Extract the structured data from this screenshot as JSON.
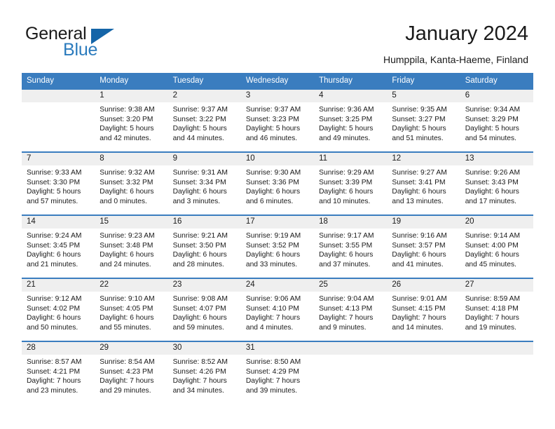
{
  "brand": {
    "name_top": "General",
    "name_bottom": "Blue",
    "triangle_icon": "blue-triangle-logo-icon",
    "color_dark": "#1a1a1a",
    "color_blue": "#2b7bbd"
  },
  "header": {
    "title": "January 2024",
    "subtitle": "Humppila, Kanta-Haeme, Finland"
  },
  "theme": {
    "header_blue": "#3a7dbf",
    "daynum_band": "#efefef",
    "text": "#1a1a1a"
  },
  "calendar": {
    "weekdays": [
      "Sunday",
      "Monday",
      "Tuesday",
      "Wednesday",
      "Thursday",
      "Friday",
      "Saturday"
    ],
    "weeks": [
      [
        {
          "day": "",
          "sunrise": "",
          "sunset": "",
          "daylight_line1": "",
          "daylight_line2": ""
        },
        {
          "day": "1",
          "sunrise": "Sunrise: 9:38 AM",
          "sunset": "Sunset: 3:20 PM",
          "daylight_line1": "Daylight: 5 hours",
          "daylight_line2": "and 42 minutes."
        },
        {
          "day": "2",
          "sunrise": "Sunrise: 9:37 AM",
          "sunset": "Sunset: 3:22 PM",
          "daylight_line1": "Daylight: 5 hours",
          "daylight_line2": "and 44 minutes."
        },
        {
          "day": "3",
          "sunrise": "Sunrise: 9:37 AM",
          "sunset": "Sunset: 3:23 PM",
          "daylight_line1": "Daylight: 5 hours",
          "daylight_line2": "and 46 minutes."
        },
        {
          "day": "4",
          "sunrise": "Sunrise: 9:36 AM",
          "sunset": "Sunset: 3:25 PM",
          "daylight_line1": "Daylight: 5 hours",
          "daylight_line2": "and 49 minutes."
        },
        {
          "day": "5",
          "sunrise": "Sunrise: 9:35 AM",
          "sunset": "Sunset: 3:27 PM",
          "daylight_line1": "Daylight: 5 hours",
          "daylight_line2": "and 51 minutes."
        },
        {
          "day": "6",
          "sunrise": "Sunrise: 9:34 AM",
          "sunset": "Sunset: 3:29 PM",
          "daylight_line1": "Daylight: 5 hours",
          "daylight_line2": "and 54 minutes."
        }
      ],
      [
        {
          "day": "7",
          "sunrise": "Sunrise: 9:33 AM",
          "sunset": "Sunset: 3:30 PM",
          "daylight_line1": "Daylight: 5 hours",
          "daylight_line2": "and 57 minutes."
        },
        {
          "day": "8",
          "sunrise": "Sunrise: 9:32 AM",
          "sunset": "Sunset: 3:32 PM",
          "daylight_line1": "Daylight: 6 hours",
          "daylight_line2": "and 0 minutes."
        },
        {
          "day": "9",
          "sunrise": "Sunrise: 9:31 AM",
          "sunset": "Sunset: 3:34 PM",
          "daylight_line1": "Daylight: 6 hours",
          "daylight_line2": "and 3 minutes."
        },
        {
          "day": "10",
          "sunrise": "Sunrise: 9:30 AM",
          "sunset": "Sunset: 3:36 PM",
          "daylight_line1": "Daylight: 6 hours",
          "daylight_line2": "and 6 minutes."
        },
        {
          "day": "11",
          "sunrise": "Sunrise: 9:29 AM",
          "sunset": "Sunset: 3:39 PM",
          "daylight_line1": "Daylight: 6 hours",
          "daylight_line2": "and 10 minutes."
        },
        {
          "day": "12",
          "sunrise": "Sunrise: 9:27 AM",
          "sunset": "Sunset: 3:41 PM",
          "daylight_line1": "Daylight: 6 hours",
          "daylight_line2": "and 13 minutes."
        },
        {
          "day": "13",
          "sunrise": "Sunrise: 9:26 AM",
          "sunset": "Sunset: 3:43 PM",
          "daylight_line1": "Daylight: 6 hours",
          "daylight_line2": "and 17 minutes."
        }
      ],
      [
        {
          "day": "14",
          "sunrise": "Sunrise: 9:24 AM",
          "sunset": "Sunset: 3:45 PM",
          "daylight_line1": "Daylight: 6 hours",
          "daylight_line2": "and 21 minutes."
        },
        {
          "day": "15",
          "sunrise": "Sunrise: 9:23 AM",
          "sunset": "Sunset: 3:48 PM",
          "daylight_line1": "Daylight: 6 hours",
          "daylight_line2": "and 24 minutes."
        },
        {
          "day": "16",
          "sunrise": "Sunrise: 9:21 AM",
          "sunset": "Sunset: 3:50 PM",
          "daylight_line1": "Daylight: 6 hours",
          "daylight_line2": "and 28 minutes."
        },
        {
          "day": "17",
          "sunrise": "Sunrise: 9:19 AM",
          "sunset": "Sunset: 3:52 PM",
          "daylight_line1": "Daylight: 6 hours",
          "daylight_line2": "and 33 minutes."
        },
        {
          "day": "18",
          "sunrise": "Sunrise: 9:17 AM",
          "sunset": "Sunset: 3:55 PM",
          "daylight_line1": "Daylight: 6 hours",
          "daylight_line2": "and 37 minutes."
        },
        {
          "day": "19",
          "sunrise": "Sunrise: 9:16 AM",
          "sunset": "Sunset: 3:57 PM",
          "daylight_line1": "Daylight: 6 hours",
          "daylight_line2": "and 41 minutes."
        },
        {
          "day": "20",
          "sunrise": "Sunrise: 9:14 AM",
          "sunset": "Sunset: 4:00 PM",
          "daylight_line1": "Daylight: 6 hours",
          "daylight_line2": "and 45 minutes."
        }
      ],
      [
        {
          "day": "21",
          "sunrise": "Sunrise: 9:12 AM",
          "sunset": "Sunset: 4:02 PM",
          "daylight_line1": "Daylight: 6 hours",
          "daylight_line2": "and 50 minutes."
        },
        {
          "day": "22",
          "sunrise": "Sunrise: 9:10 AM",
          "sunset": "Sunset: 4:05 PM",
          "daylight_line1": "Daylight: 6 hours",
          "daylight_line2": "and 55 minutes."
        },
        {
          "day": "23",
          "sunrise": "Sunrise: 9:08 AM",
          "sunset": "Sunset: 4:07 PM",
          "daylight_line1": "Daylight: 6 hours",
          "daylight_line2": "and 59 minutes."
        },
        {
          "day": "24",
          "sunrise": "Sunrise: 9:06 AM",
          "sunset": "Sunset: 4:10 PM",
          "daylight_line1": "Daylight: 7 hours",
          "daylight_line2": "and 4 minutes."
        },
        {
          "day": "25",
          "sunrise": "Sunrise: 9:04 AM",
          "sunset": "Sunset: 4:13 PM",
          "daylight_line1": "Daylight: 7 hours",
          "daylight_line2": "and 9 minutes."
        },
        {
          "day": "26",
          "sunrise": "Sunrise: 9:01 AM",
          "sunset": "Sunset: 4:15 PM",
          "daylight_line1": "Daylight: 7 hours",
          "daylight_line2": "and 14 minutes."
        },
        {
          "day": "27",
          "sunrise": "Sunrise: 8:59 AM",
          "sunset": "Sunset: 4:18 PM",
          "daylight_line1": "Daylight: 7 hours",
          "daylight_line2": "and 19 minutes."
        }
      ],
      [
        {
          "day": "28",
          "sunrise": "Sunrise: 8:57 AM",
          "sunset": "Sunset: 4:21 PM",
          "daylight_line1": "Daylight: 7 hours",
          "daylight_line2": "and 23 minutes."
        },
        {
          "day": "29",
          "sunrise": "Sunrise: 8:54 AM",
          "sunset": "Sunset: 4:23 PM",
          "daylight_line1": "Daylight: 7 hours",
          "daylight_line2": "and 29 minutes."
        },
        {
          "day": "30",
          "sunrise": "Sunrise: 8:52 AM",
          "sunset": "Sunset: 4:26 PM",
          "daylight_line1": "Daylight: 7 hours",
          "daylight_line2": "and 34 minutes."
        },
        {
          "day": "31",
          "sunrise": "Sunrise: 8:50 AM",
          "sunset": "Sunset: 4:29 PM",
          "daylight_line1": "Daylight: 7 hours",
          "daylight_line2": "and 39 minutes."
        },
        {
          "day": "",
          "sunrise": "",
          "sunset": "",
          "daylight_line1": "",
          "daylight_line2": ""
        },
        {
          "day": "",
          "sunrise": "",
          "sunset": "",
          "daylight_line1": "",
          "daylight_line2": ""
        },
        {
          "day": "",
          "sunrise": "",
          "sunset": "",
          "daylight_line1": "",
          "daylight_line2": ""
        }
      ]
    ]
  }
}
